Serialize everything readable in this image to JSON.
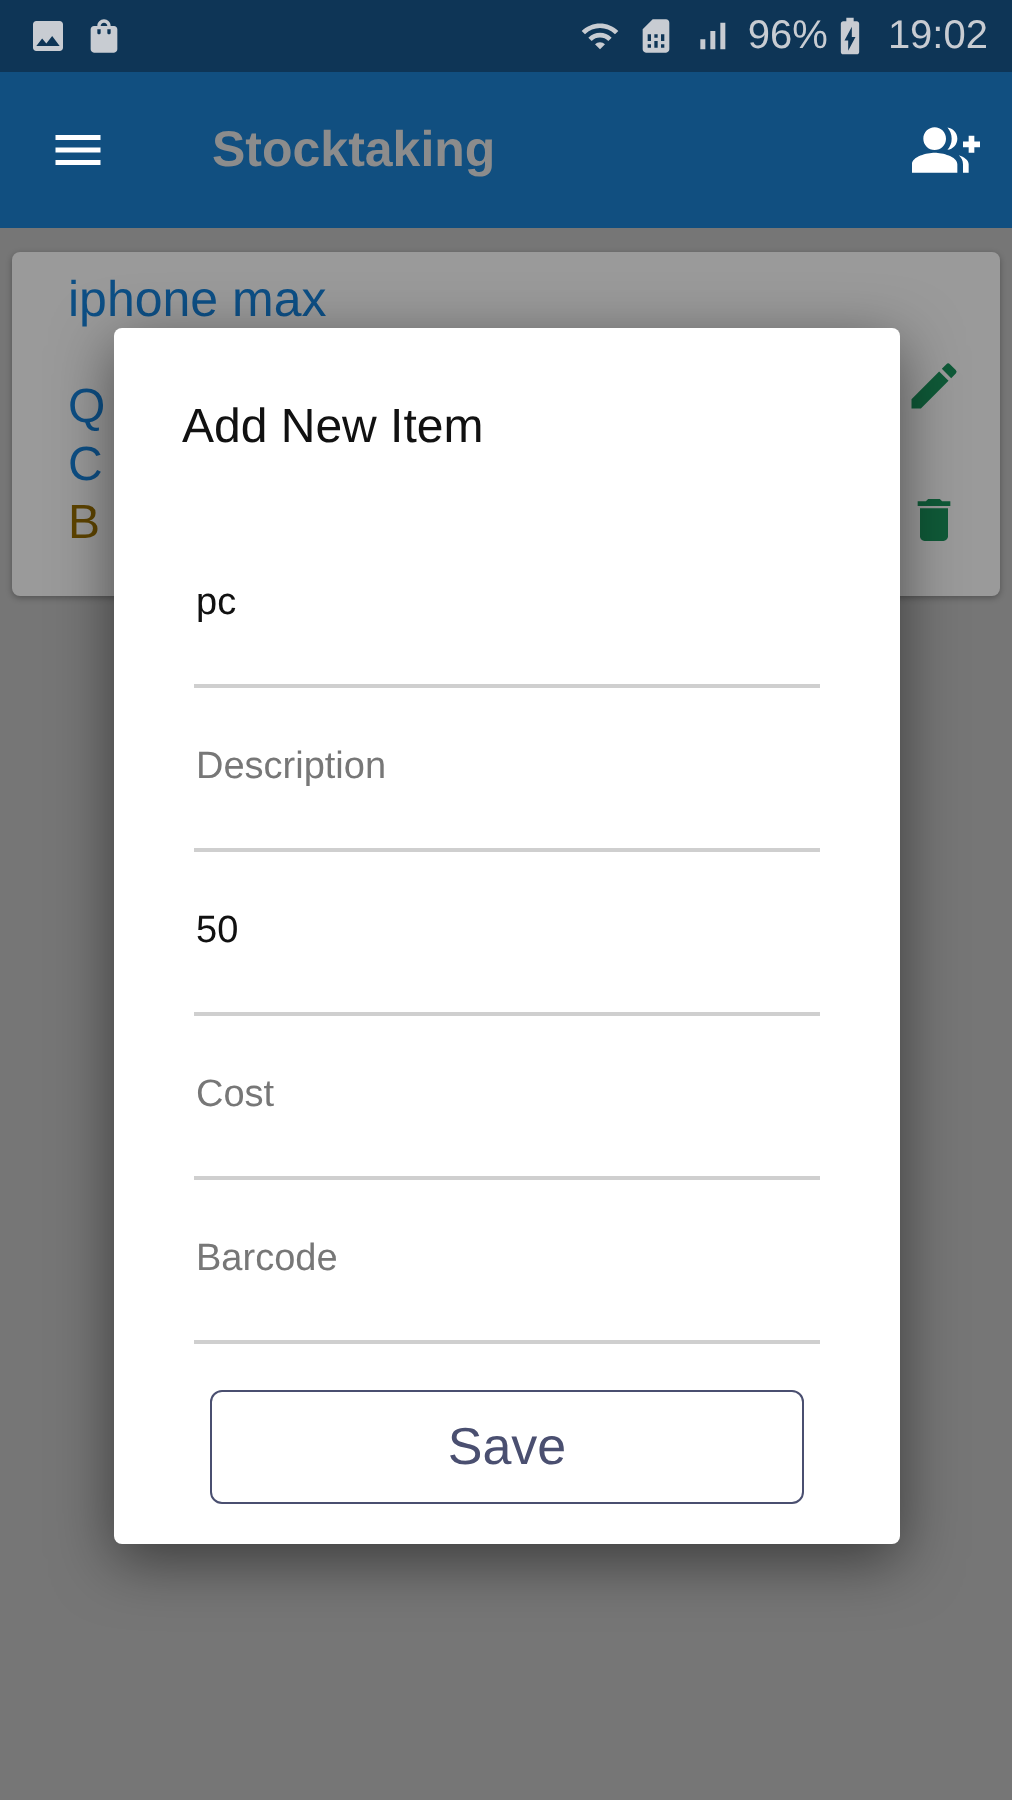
{
  "status_bar": {
    "battery": "96%",
    "time": "19:02"
  },
  "app_bar": {
    "title": "Stocktaking"
  },
  "item_card": {
    "name": "iphone max",
    "lines": [
      {
        "text": "Q",
        "color": "#0d4f85"
      },
      {
        "text": "C",
        "color": "#0d4f85"
      },
      {
        "text": "B",
        "color": "#5e4400"
      }
    ]
  },
  "dialog": {
    "title": "Add New Item",
    "fields": [
      {
        "value": "pc"
      },
      {
        "placeholder": "Description"
      },
      {
        "value": "50"
      },
      {
        "placeholder": "Cost"
      },
      {
        "placeholder": "Barcode"
      }
    ],
    "button": "Save"
  }
}
